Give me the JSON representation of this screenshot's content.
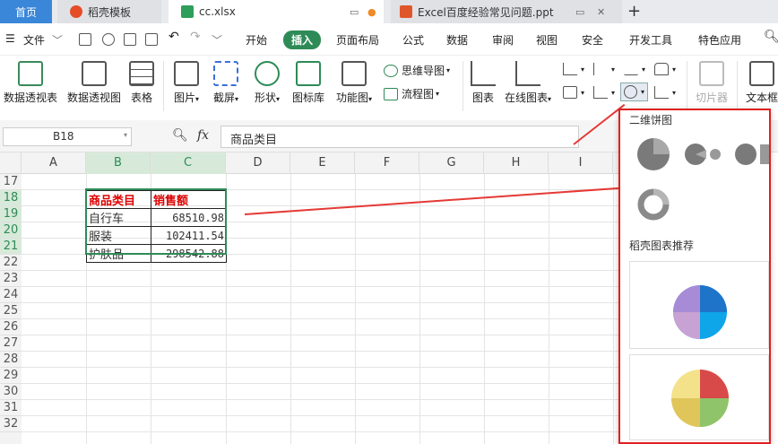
{
  "tabs": {
    "home": "首页",
    "templates": "稻壳模板",
    "file1": "cc.xlsx",
    "file2": "Excel百度经验常见问题.ppt",
    "new_tab": "+"
  },
  "menu": {
    "file": "文件",
    "items": [
      "开始",
      "插入",
      "页面布局",
      "公式",
      "数据",
      "审阅",
      "视图",
      "安全",
      "开发工具",
      "特色应用"
    ],
    "active": "插入"
  },
  "ribbon": {
    "pivot_table": "数据透视表",
    "pivot_chart": "数据透视图",
    "table": "表格",
    "picture": "图片",
    "screenshot": "截屏",
    "shape": "形状",
    "icon_lib": "图标库",
    "func_chart": "功能图",
    "mindmap": "思维导图",
    "flowchart": "流程图",
    "chart": "图表",
    "online_chart": "在线图表",
    "slicer": "切片器",
    "textbox": "文本框"
  },
  "formula_bar": {
    "name_box": "B18",
    "fx": "fx",
    "value": "商品类目"
  },
  "columns": [
    "A",
    "B",
    "C",
    "D",
    "E",
    "F",
    "G",
    "H",
    "I"
  ],
  "rows": [
    "17",
    "18",
    "19",
    "20",
    "21",
    "22",
    "23",
    "24",
    "25",
    "26",
    "27",
    "28",
    "29",
    "30",
    "31",
    "32"
  ],
  "table": {
    "headers": [
      "商品类目",
      "销售额"
    ],
    "rows": [
      [
        "自行车",
        "68510.98"
      ],
      [
        "服装",
        "102411.54"
      ],
      [
        "护肤品",
        "298542.88"
      ]
    ]
  },
  "dropdown": {
    "section1": "二维饼图",
    "section2": "稻壳图表推荐"
  },
  "colors": {
    "accent_green": "#2e8b57",
    "home_tab": "#3a86d8",
    "highlight_red": "#e02020",
    "header_text_red": "#dd0000"
  }
}
